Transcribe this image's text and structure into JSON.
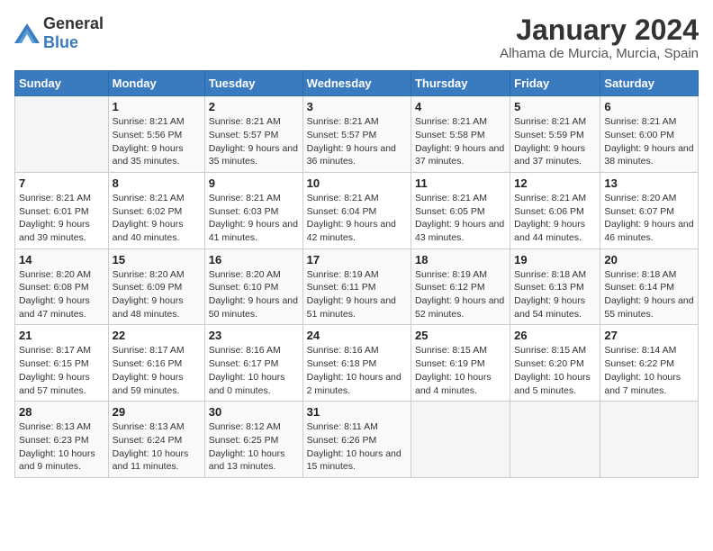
{
  "logo": {
    "general": "General",
    "blue": "Blue"
  },
  "title": "January 2024",
  "subtitle": "Alhama de Murcia, Murcia, Spain",
  "days_of_week": [
    "Sunday",
    "Monday",
    "Tuesday",
    "Wednesday",
    "Thursday",
    "Friday",
    "Saturday"
  ],
  "weeks": [
    [
      {
        "day": "",
        "sunrise": "",
        "sunset": "",
        "daylight": ""
      },
      {
        "day": "1",
        "sunrise": "Sunrise: 8:21 AM",
        "sunset": "Sunset: 5:56 PM",
        "daylight": "Daylight: 9 hours and 35 minutes."
      },
      {
        "day": "2",
        "sunrise": "Sunrise: 8:21 AM",
        "sunset": "Sunset: 5:57 PM",
        "daylight": "Daylight: 9 hours and 35 minutes."
      },
      {
        "day": "3",
        "sunrise": "Sunrise: 8:21 AM",
        "sunset": "Sunset: 5:57 PM",
        "daylight": "Daylight: 9 hours and 36 minutes."
      },
      {
        "day": "4",
        "sunrise": "Sunrise: 8:21 AM",
        "sunset": "Sunset: 5:58 PM",
        "daylight": "Daylight: 9 hours and 37 minutes."
      },
      {
        "day": "5",
        "sunrise": "Sunrise: 8:21 AM",
        "sunset": "Sunset: 5:59 PM",
        "daylight": "Daylight: 9 hours and 37 minutes."
      },
      {
        "day": "6",
        "sunrise": "Sunrise: 8:21 AM",
        "sunset": "Sunset: 6:00 PM",
        "daylight": "Daylight: 9 hours and 38 minutes."
      }
    ],
    [
      {
        "day": "7",
        "sunrise": "Sunrise: 8:21 AM",
        "sunset": "Sunset: 6:01 PM",
        "daylight": "Daylight: 9 hours and 39 minutes."
      },
      {
        "day": "8",
        "sunrise": "Sunrise: 8:21 AM",
        "sunset": "Sunset: 6:02 PM",
        "daylight": "Daylight: 9 hours and 40 minutes."
      },
      {
        "day": "9",
        "sunrise": "Sunrise: 8:21 AM",
        "sunset": "Sunset: 6:03 PM",
        "daylight": "Daylight: 9 hours and 41 minutes."
      },
      {
        "day": "10",
        "sunrise": "Sunrise: 8:21 AM",
        "sunset": "Sunset: 6:04 PM",
        "daylight": "Daylight: 9 hours and 42 minutes."
      },
      {
        "day": "11",
        "sunrise": "Sunrise: 8:21 AM",
        "sunset": "Sunset: 6:05 PM",
        "daylight": "Daylight: 9 hours and 43 minutes."
      },
      {
        "day": "12",
        "sunrise": "Sunrise: 8:21 AM",
        "sunset": "Sunset: 6:06 PM",
        "daylight": "Daylight: 9 hours and 44 minutes."
      },
      {
        "day": "13",
        "sunrise": "Sunrise: 8:20 AM",
        "sunset": "Sunset: 6:07 PM",
        "daylight": "Daylight: 9 hours and 46 minutes."
      }
    ],
    [
      {
        "day": "14",
        "sunrise": "Sunrise: 8:20 AM",
        "sunset": "Sunset: 6:08 PM",
        "daylight": "Daylight: 9 hours and 47 minutes."
      },
      {
        "day": "15",
        "sunrise": "Sunrise: 8:20 AM",
        "sunset": "Sunset: 6:09 PM",
        "daylight": "Daylight: 9 hours and 48 minutes."
      },
      {
        "day": "16",
        "sunrise": "Sunrise: 8:20 AM",
        "sunset": "Sunset: 6:10 PM",
        "daylight": "Daylight: 9 hours and 50 minutes."
      },
      {
        "day": "17",
        "sunrise": "Sunrise: 8:19 AM",
        "sunset": "Sunset: 6:11 PM",
        "daylight": "Daylight: 9 hours and 51 minutes."
      },
      {
        "day": "18",
        "sunrise": "Sunrise: 8:19 AM",
        "sunset": "Sunset: 6:12 PM",
        "daylight": "Daylight: 9 hours and 52 minutes."
      },
      {
        "day": "19",
        "sunrise": "Sunrise: 8:18 AM",
        "sunset": "Sunset: 6:13 PM",
        "daylight": "Daylight: 9 hours and 54 minutes."
      },
      {
        "day": "20",
        "sunrise": "Sunrise: 8:18 AM",
        "sunset": "Sunset: 6:14 PM",
        "daylight": "Daylight: 9 hours and 55 minutes."
      }
    ],
    [
      {
        "day": "21",
        "sunrise": "Sunrise: 8:17 AM",
        "sunset": "Sunset: 6:15 PM",
        "daylight": "Daylight: 9 hours and 57 minutes."
      },
      {
        "day": "22",
        "sunrise": "Sunrise: 8:17 AM",
        "sunset": "Sunset: 6:16 PM",
        "daylight": "Daylight: 9 hours and 59 minutes."
      },
      {
        "day": "23",
        "sunrise": "Sunrise: 8:16 AM",
        "sunset": "Sunset: 6:17 PM",
        "daylight": "Daylight: 10 hours and 0 minutes."
      },
      {
        "day": "24",
        "sunrise": "Sunrise: 8:16 AM",
        "sunset": "Sunset: 6:18 PM",
        "daylight": "Daylight: 10 hours and 2 minutes."
      },
      {
        "day": "25",
        "sunrise": "Sunrise: 8:15 AM",
        "sunset": "Sunset: 6:19 PM",
        "daylight": "Daylight: 10 hours and 4 minutes."
      },
      {
        "day": "26",
        "sunrise": "Sunrise: 8:15 AM",
        "sunset": "Sunset: 6:20 PM",
        "daylight": "Daylight: 10 hours and 5 minutes."
      },
      {
        "day": "27",
        "sunrise": "Sunrise: 8:14 AM",
        "sunset": "Sunset: 6:22 PM",
        "daylight": "Daylight: 10 hours and 7 minutes."
      }
    ],
    [
      {
        "day": "28",
        "sunrise": "Sunrise: 8:13 AM",
        "sunset": "Sunset: 6:23 PM",
        "daylight": "Daylight: 10 hours and 9 minutes."
      },
      {
        "day": "29",
        "sunrise": "Sunrise: 8:13 AM",
        "sunset": "Sunset: 6:24 PM",
        "daylight": "Daylight: 10 hours and 11 minutes."
      },
      {
        "day": "30",
        "sunrise": "Sunrise: 8:12 AM",
        "sunset": "Sunset: 6:25 PM",
        "daylight": "Daylight: 10 hours and 13 minutes."
      },
      {
        "day": "31",
        "sunrise": "Sunrise: 8:11 AM",
        "sunset": "Sunset: 6:26 PM",
        "daylight": "Daylight: 10 hours and 15 minutes."
      },
      {
        "day": "",
        "sunrise": "",
        "sunset": "",
        "daylight": ""
      },
      {
        "day": "",
        "sunrise": "",
        "sunset": "",
        "daylight": ""
      },
      {
        "day": "",
        "sunrise": "",
        "sunset": "",
        "daylight": ""
      }
    ]
  ]
}
